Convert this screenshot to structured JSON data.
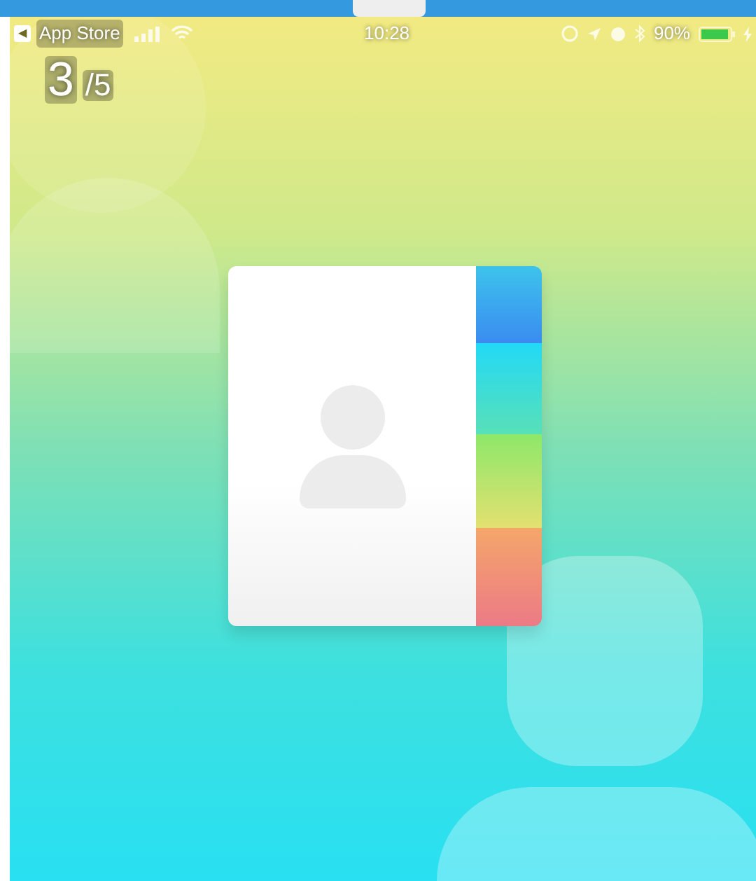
{
  "status_bar": {
    "back_icon": "◀",
    "back_label": "App Store",
    "time": "10:28",
    "battery": "90%"
  },
  "page_indicator": {
    "current": "3",
    "total": "/5"
  }
}
